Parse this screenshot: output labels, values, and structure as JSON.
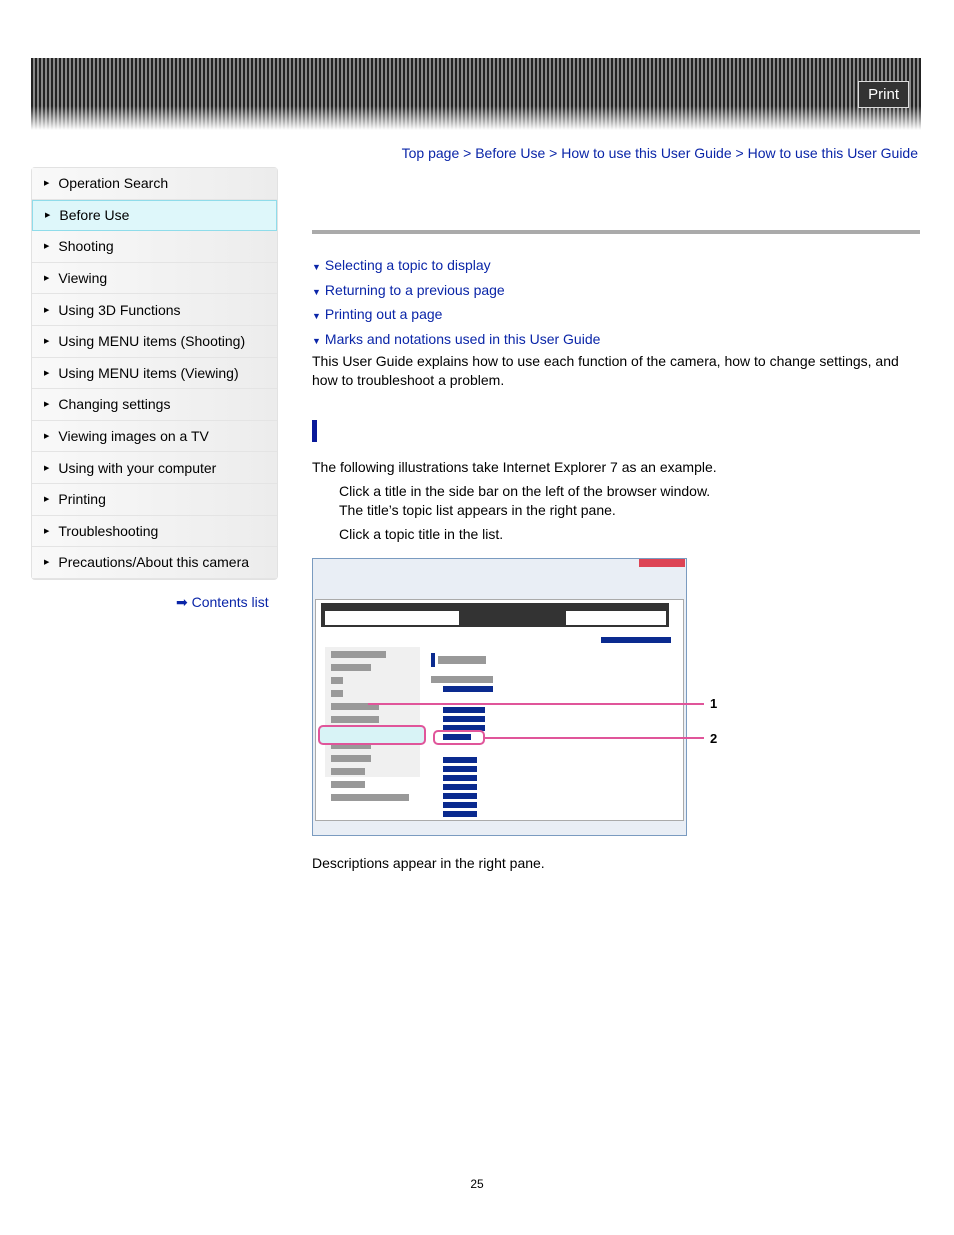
{
  "header": {
    "print_label": "Print"
  },
  "breadcrumb": [
    "Top page",
    "Before Use",
    "How to use this User Guide",
    "How to use this User Guide"
  ],
  "sidebar": {
    "items": [
      "Operation Search",
      "Before Use",
      "Shooting",
      "Viewing",
      "Using 3D Functions",
      "Using MENU items (Shooting)",
      "Using MENU items (Viewing)",
      "Changing settings",
      "Viewing images on a TV",
      "Using with your computer",
      "Printing",
      "Troubleshooting",
      "Precautions/About this camera"
    ],
    "selected": "Before Use",
    "contents_list": "Contents list"
  },
  "toc": [
    "Selecting a topic to display",
    "Returning to a previous page",
    "Printing out a page",
    "Marks and notations used in this User Guide"
  ],
  "intro": "This User Guide explains how to use each function of the camera, how to change settings, and how to troubleshoot a problem.",
  "section": {
    "example": "The following illustrations take Internet Explorer 7 as an example.",
    "step1": "Click a title in the side bar on the left of the browser window.",
    "step1b": "The title’s topic list appears in the right pane.",
    "step2": "Click a topic title in the list.",
    "callout1": "1",
    "callout2": "2",
    "after": "Descriptions appear in the right pane."
  },
  "page_number": "25",
  "colors": {
    "link": "#0a25a8",
    "highlight": "#def7fa",
    "callout": "#e0559a"
  }
}
